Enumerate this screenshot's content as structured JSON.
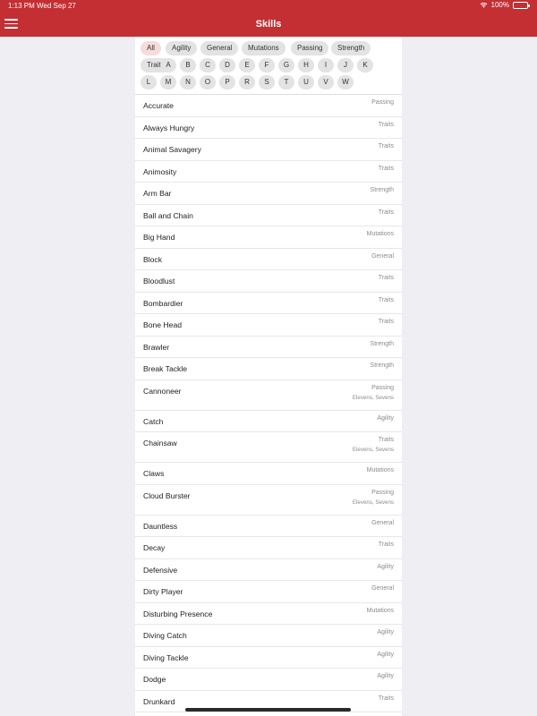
{
  "status": {
    "time": "1:13 PM",
    "date": "Wed Sep 27",
    "battery": "100%",
    "battery_level": 1.0
  },
  "header": {
    "title": "Skills",
    "menu_icon": "hamburger-menu-icon"
  },
  "filters": {
    "categories": [
      "All",
      "Agility",
      "General",
      "Mutations",
      "Passing",
      "Strength",
      "Traits"
    ],
    "active": "All",
    "letters": [
      "A",
      "B",
      "C",
      "D",
      "E",
      "F",
      "G",
      "H",
      "I",
      "J",
      "K",
      "L",
      "M",
      "N",
      "O",
      "P",
      "R",
      "S",
      "T",
      "U",
      "V",
      "W"
    ]
  },
  "skills": [
    {
      "name": "Accurate",
      "category": "Passing",
      "editions": ""
    },
    {
      "name": "Always Hungry",
      "category": "Traits",
      "editions": ""
    },
    {
      "name": "Animal Savagery",
      "category": "Traits",
      "editions": ""
    },
    {
      "name": "Animosity",
      "category": "Traits",
      "editions": ""
    },
    {
      "name": "Arm Bar",
      "category": "Strength",
      "editions": ""
    },
    {
      "name": "Ball and Chain",
      "category": "Traits",
      "editions": ""
    },
    {
      "name": "Big Hand",
      "category": "Mutations",
      "editions": ""
    },
    {
      "name": "Block",
      "category": "General",
      "editions": ""
    },
    {
      "name": "Bloodlust",
      "category": "Traits",
      "editions": ""
    },
    {
      "name": "Bombardier",
      "category": "Traits",
      "editions": ""
    },
    {
      "name": "Bone Head",
      "category": "Traits",
      "editions": ""
    },
    {
      "name": "Brawler",
      "category": "Strength",
      "editions": ""
    },
    {
      "name": "Break Tackle",
      "category": "Strength",
      "editions": ""
    },
    {
      "name": "Cannoneer",
      "category": "Passing",
      "editions": "Elevens, Sevens"
    },
    {
      "name": "Catch",
      "category": "Agility",
      "editions": ""
    },
    {
      "name": "Chainsaw",
      "category": "Traits",
      "editions": "Elevens, Sevens"
    },
    {
      "name": "Claws",
      "category": "Mutations",
      "editions": ""
    },
    {
      "name": "Cloud Burster",
      "category": "Passing",
      "editions": "Elevens, Sevens"
    },
    {
      "name": "Dauntless",
      "category": "General",
      "editions": ""
    },
    {
      "name": "Decay",
      "category": "Traits",
      "editions": ""
    },
    {
      "name": "Defensive",
      "category": "Agility",
      "editions": ""
    },
    {
      "name": "Dirty Player",
      "category": "General",
      "editions": ""
    },
    {
      "name": "Disturbing Presence",
      "category": "Mutations",
      "editions": ""
    },
    {
      "name": "Diving Catch",
      "category": "Agility",
      "editions": ""
    },
    {
      "name": "Diving Tackle",
      "category": "Agility",
      "editions": ""
    },
    {
      "name": "Dodge",
      "category": "Agility",
      "editions": ""
    },
    {
      "name": "Drunkard",
      "category": "Traits",
      "editions": ""
    }
  ]
}
